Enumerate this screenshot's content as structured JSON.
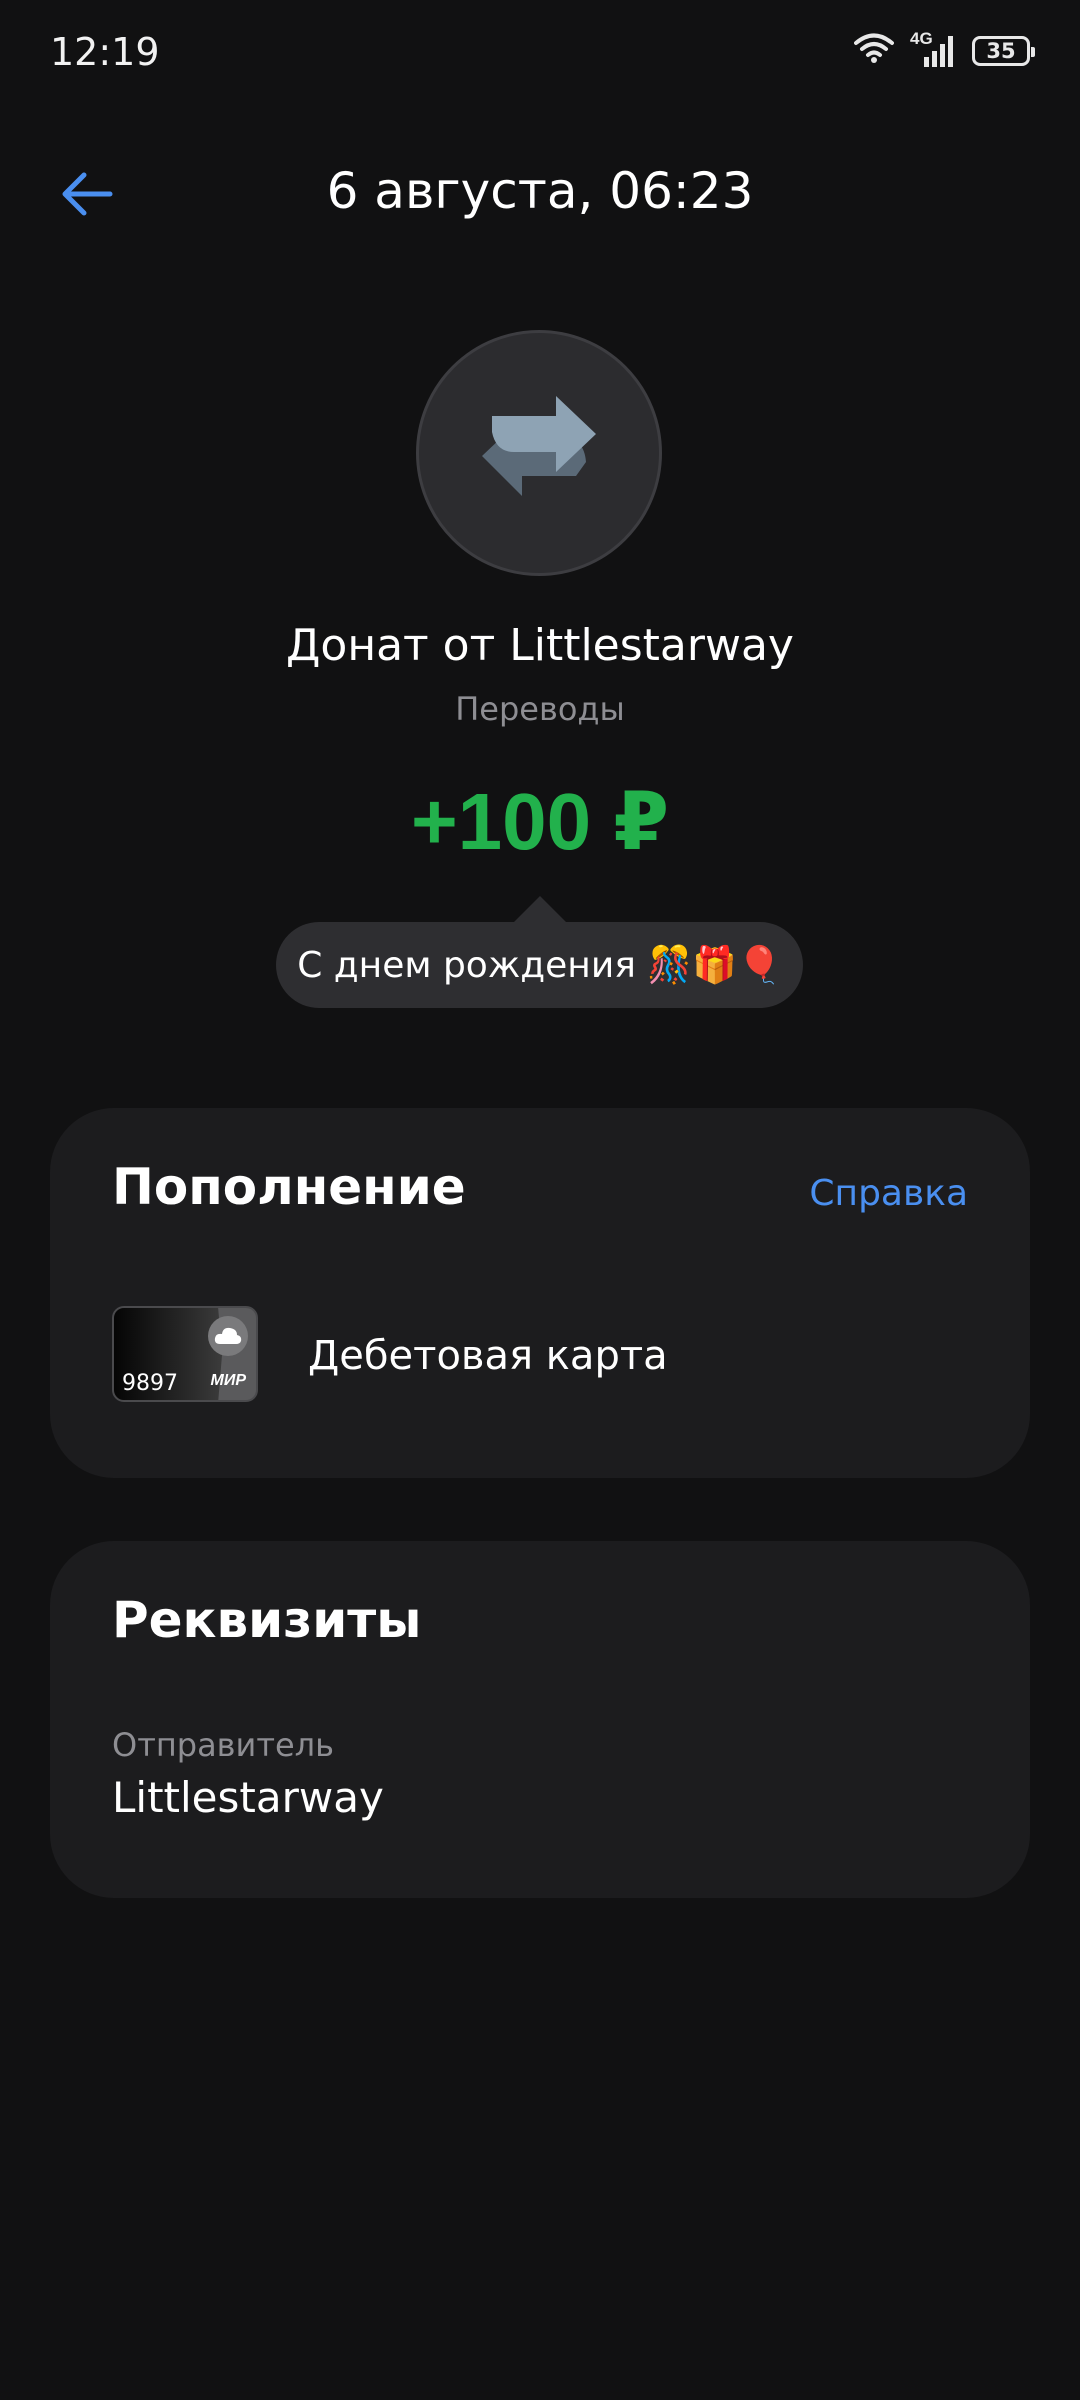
{
  "status_bar": {
    "time": "12:19",
    "network": "4G",
    "battery": "35",
    "icons": [
      "wifi-icon",
      "signal-icon",
      "battery-icon"
    ]
  },
  "header": {
    "title": "6 августа, 06:23",
    "back_icon": "arrow-left-icon"
  },
  "operation": {
    "icon": "transfer-arrows-icon",
    "title": "Донат от Littlestarway",
    "category": "Переводы",
    "amount": "+100 ₽",
    "message": "С днем рождения 🎊🎁🎈"
  },
  "topup_section": {
    "heading": "Пополнение",
    "help_link": "Справка",
    "card": {
      "last4": "9897",
      "payment_system": "МИР",
      "type_label": "Дебетовая карта"
    }
  },
  "details_section": {
    "heading": "Реквизиты",
    "sender_label": "Отправитель",
    "sender_value": "Littlestarway"
  },
  "colors": {
    "background": "#111112",
    "card_background": "#1c1c1e",
    "accent": "#4a8ff0",
    "income": "#22b14c",
    "secondary_text": "#8e8e93"
  }
}
